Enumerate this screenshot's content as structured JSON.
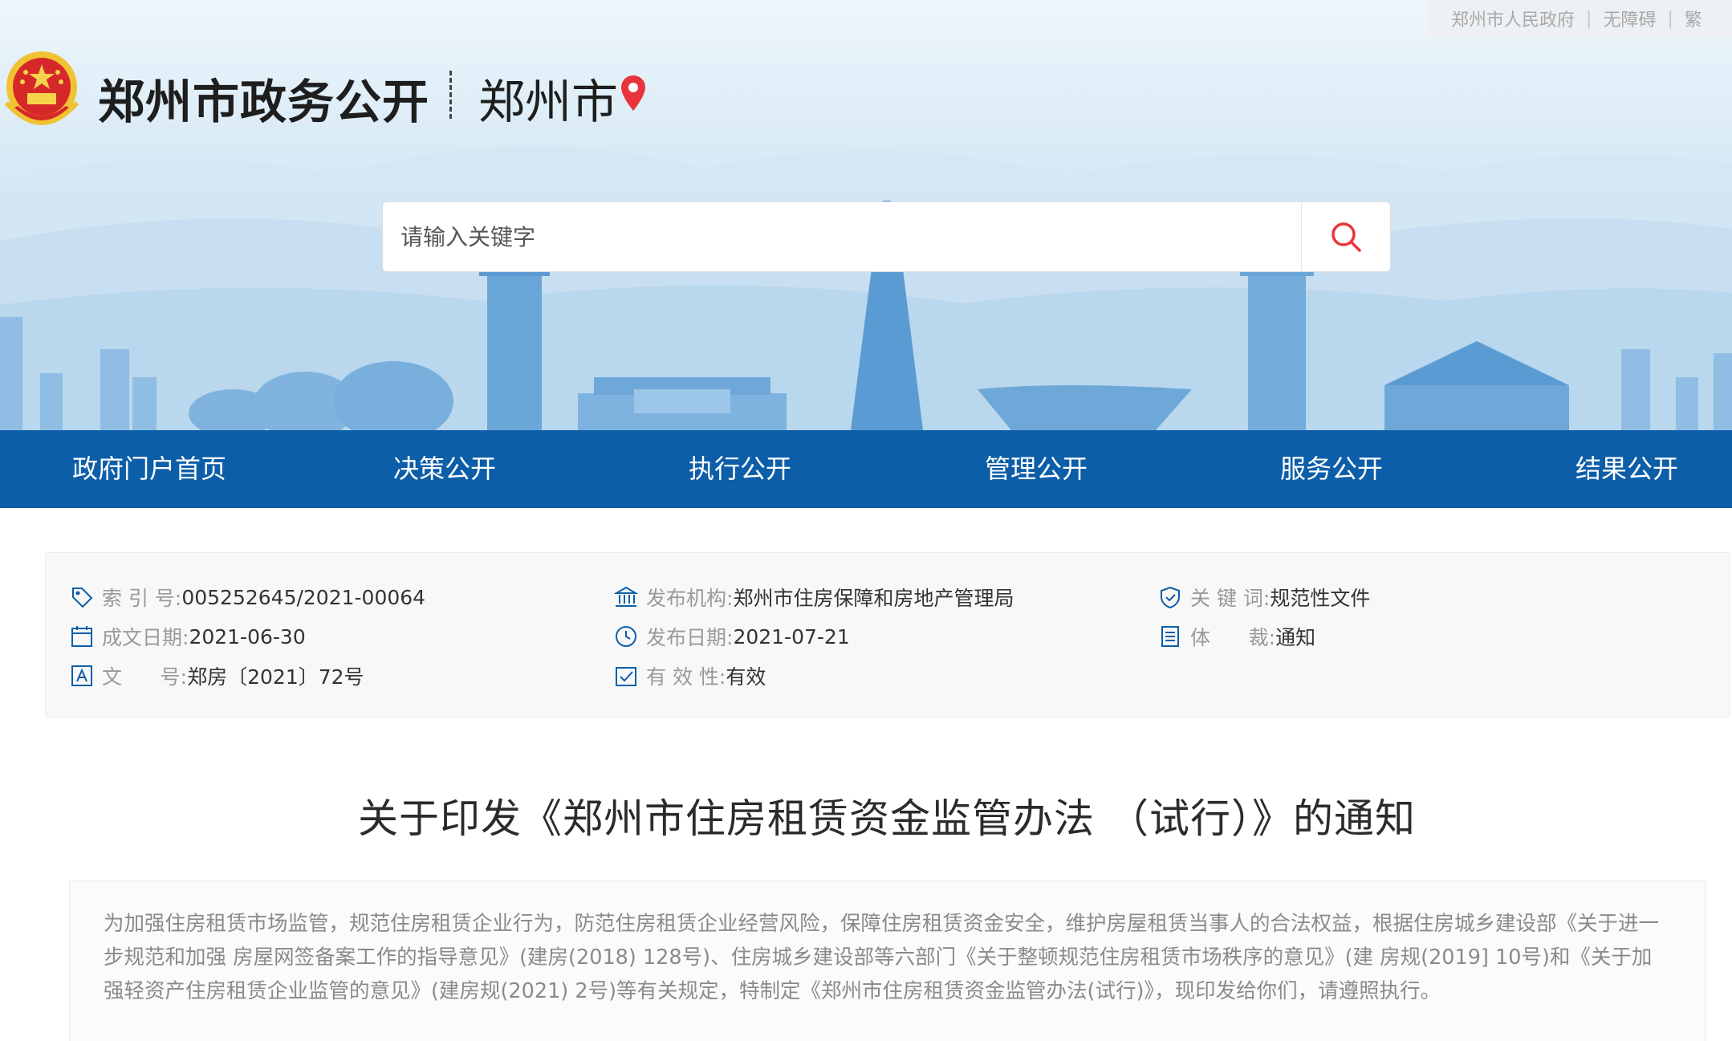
{
  "top_links": {
    "gov": "郑州市人民政府",
    "sep": "|",
    "accessibility": "无障碍",
    "more": "繁"
  },
  "header": {
    "site_title": "郑州市政务公开",
    "city": "郑州市"
  },
  "search": {
    "placeholder": "请输入关键字"
  },
  "nav": {
    "items": [
      {
        "label": "政府门户首页"
      },
      {
        "label": "决策公开"
      },
      {
        "label": "执行公开"
      },
      {
        "label": "管理公开"
      },
      {
        "label": "服务公开"
      },
      {
        "label": "结果公开"
      }
    ]
  },
  "meta": {
    "index_label": "索 引 号:",
    "index_value": "005252645/2021-00064",
    "date_created_label": "成文日期:",
    "date_created_value": "2021-06-30",
    "doc_no_label": "文      号:",
    "doc_no_value": "郑房〔2021〕72号",
    "publisher_label": "发布机构:",
    "publisher_value": "郑州市住房保障和房地产管理局",
    "publish_date_label": "发布日期:",
    "publish_date_value": "2021-07-21",
    "validity_label": "有 效 性:",
    "validity_value": "有效",
    "keywords_label": "关 键 词:",
    "keywords_value": "规范性文件",
    "genre_label": "体      裁:",
    "genre_value": "通知"
  },
  "document": {
    "title": "关于印发《郑州市住房租赁资金监管办法 （试行）》的通知",
    "paragraph": "为加强住房租赁市场监管，规范住房租赁企业行为，防范住房租赁企业经营风险，保障住房租赁资金安全，维护房屋租赁当事人的合法权益，根据住房城乡建设部《关于进一步规范和加强 房屋网签备案工作的指导意见》(建房(2018) 128号)、住房城乡建设部等六部门《关于整顿规范住房租赁市场秩序的意见》(建 房规(2019] 10号)和《关于加强轻资产住房租赁企业监管的意见》(建房规(2021) 2号)等有关规定，特制定《郑州市住房租赁资金监管办法(试行)》，现印发给你们，请遵照执行。"
  },
  "colors": {
    "nav_bg": "#0d5ea8",
    "accent_red": "#e8343a"
  }
}
